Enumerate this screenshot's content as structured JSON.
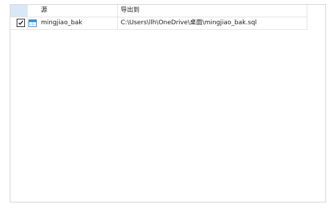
{
  "table": {
    "columns": {
      "source": "源",
      "export_to": "导出到"
    },
    "rows": [
      {
        "checked": true,
        "source": "mingjiao_bak",
        "export_to": "C:\\Users\\llh\\OneDrive\\桌面\\mingjiao_bak.sql"
      }
    ]
  },
  "icons": {
    "row_icon": "table-icon",
    "check_mark": "checkmark-icon"
  }
}
